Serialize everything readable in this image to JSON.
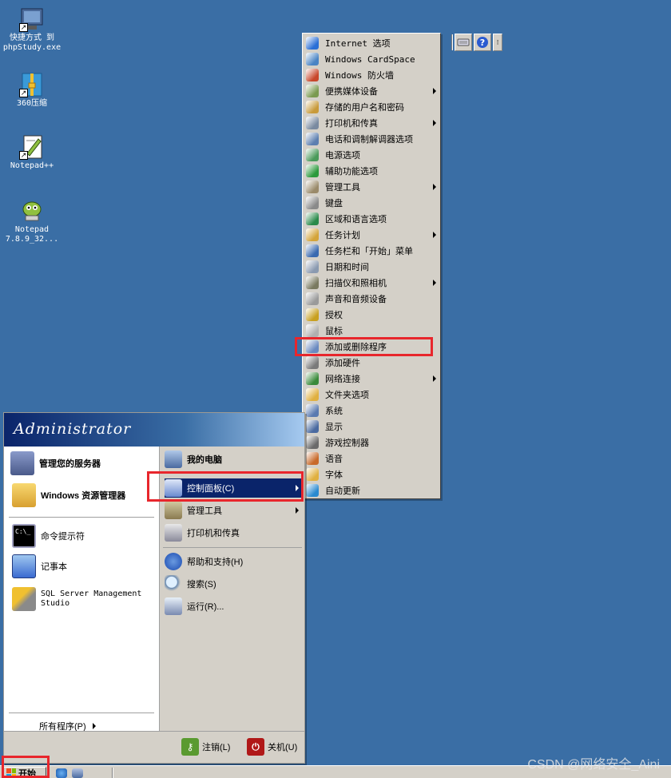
{
  "desktop": {
    "icons": [
      {
        "label": "快捷方式 到\nphpStudy.exe",
        "icon": "phpstudy-shortcut-icon"
      },
      {
        "label": "360压缩",
        "icon": "archive-360-icon"
      },
      {
        "label": "Notepad++",
        "icon": "notepadpp-icon"
      },
      {
        "label": "Notepad\n7.8.9_32...",
        "icon": "notepad-installer-icon"
      }
    ]
  },
  "control_panel_menu": {
    "items": [
      {
        "label": "Internet 选项",
        "color": "#2a6fd6",
        "submenu": false
      },
      {
        "label": "Windows CardSpace",
        "color": "#4a84c4",
        "submenu": false
      },
      {
        "label": "Windows 防火墙",
        "color": "#c8472b",
        "submenu": false
      },
      {
        "label": "便携媒体设备",
        "color": "#7a9a50",
        "submenu": true
      },
      {
        "label": "存储的用户名和密码",
        "color": "#c89a3a",
        "submenu": false
      },
      {
        "label": "打印机和传真",
        "color": "#7a8aa0",
        "submenu": true
      },
      {
        "label": "电话和调制解调器选项",
        "color": "#5d7fb0",
        "submenu": false
      },
      {
        "label": "电源选项",
        "color": "#4a9a5a",
        "submenu": false
      },
      {
        "label": "辅助功能选项",
        "color": "#2c9a3c",
        "submenu": false
      },
      {
        "label": "管理工具",
        "color": "#9a8a6a",
        "submenu": true
      },
      {
        "label": "键盘",
        "color": "#8a8a8a",
        "submenu": false
      },
      {
        "label": "区域和语言选项",
        "color": "#2a8a4a",
        "submenu": false
      },
      {
        "label": "任务计划",
        "color": "#d4a43a",
        "submenu": true
      },
      {
        "label": "任务栏和「开始」菜单",
        "color": "#3a6ab0",
        "submenu": false
      },
      {
        "label": "日期和时间",
        "color": "#8a9ab0",
        "submenu": false
      },
      {
        "label": "扫描仪和照相机",
        "color": "#7a7a60",
        "submenu": true
      },
      {
        "label": "声音和音频设备",
        "color": "#9a9a9a",
        "submenu": false
      },
      {
        "label": "授权",
        "color": "#c8a020",
        "submenu": false
      },
      {
        "label": "鼠标",
        "color": "#b0b0b0",
        "submenu": false
      },
      {
        "label": "添加或删除程序",
        "color": "#6a8ac0",
        "submenu": false
      },
      {
        "label": "添加硬件",
        "color": "#7a7a7a",
        "submenu": false
      },
      {
        "label": "网络连接",
        "color": "#3a8a3a",
        "submenu": true
      },
      {
        "label": "文件夹选项",
        "color": "#e0b040",
        "submenu": false
      },
      {
        "label": "系统",
        "color": "#5a7ab0",
        "submenu": false
      },
      {
        "label": "显示",
        "color": "#4a6aa0",
        "submenu": false
      },
      {
        "label": "游戏控制器",
        "color": "#6a6a6a",
        "submenu": false
      },
      {
        "label": "语音",
        "color": "#c86a2a",
        "submenu": false
      },
      {
        "label": "字体",
        "color": "#e0b040",
        "submenu": false
      },
      {
        "label": "自动更新",
        "color": "#2a8ad0",
        "submenu": false
      }
    ]
  },
  "start_menu": {
    "user": "Administrator",
    "pinned": [
      {
        "label": "管理您的服务器",
        "bold": true,
        "color": "#5a6a9a"
      },
      {
        "label": "Windows 资源管理器",
        "bold": true,
        "color": "#e0b040"
      }
    ],
    "recent": [
      {
        "label": "命令提示符",
        "color": "#000000"
      },
      {
        "label": "记事本",
        "color": "#4a7ad0"
      },
      {
        "label": "SQL Server Management\nStudio",
        "color": "#d4a43a"
      }
    ],
    "all_programs": "所有程序(P)",
    "right_items": [
      {
        "label": "我的电脑",
        "bold": true,
        "color": "#4a6aa0"
      },
      {
        "label": "控制面板(C)",
        "color": "#4a8ad0",
        "submenu": true,
        "active": true
      },
      {
        "label": "管理工具",
        "color": "#9a8a6a",
        "submenu": true
      },
      {
        "label": "打印机和传真",
        "color": "#7a8aa0"
      },
      {
        "label": "帮助和支持(H)",
        "color": "#2a6ad0"
      },
      {
        "label": "搜索(S)",
        "color": "#6a8ab0"
      },
      {
        "label": "运行(R)...",
        "color": "#7a8ab0"
      }
    ],
    "logoff": "注销(L)",
    "shutdown": "关机(U)"
  },
  "taskbar": {
    "start_label": "开始"
  },
  "watermark": "CSDN @网络安全_Aini",
  "colors": {
    "desktop": "#3a6ea5",
    "menu_face": "#d4d0c8",
    "highlight": "#0a246a",
    "annotation_red": "#e8262c"
  }
}
